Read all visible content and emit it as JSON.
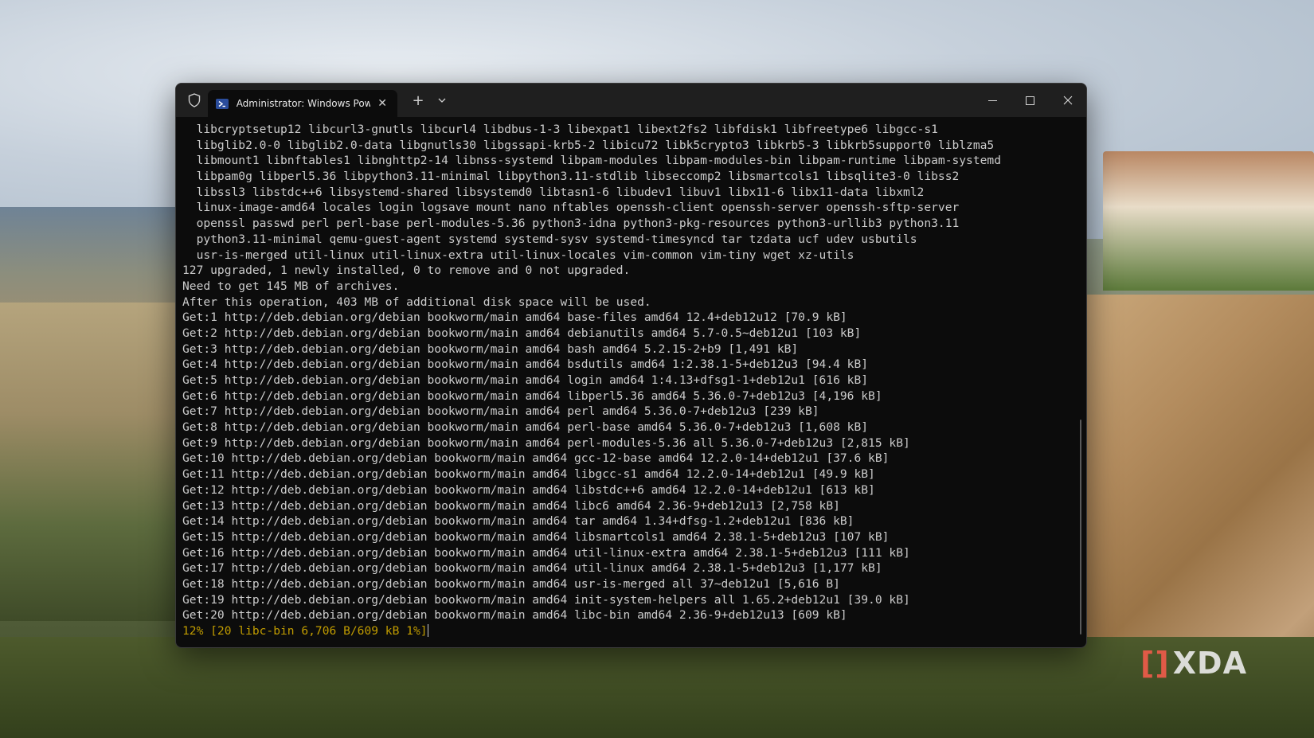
{
  "window": {
    "tab_title": "Administrator: Windows Powe",
    "new_tab_symbol": "+",
    "close_tab_symbol": "✕"
  },
  "terminal": {
    "package_lines": [
      "  libcryptsetup12 libcurl3-gnutls libcurl4 libdbus-1-3 libexpat1 libext2fs2 libfdisk1 libfreetype6 libgcc-s1",
      "  libglib2.0-0 libglib2.0-data libgnutls30 libgssapi-krb5-2 libicu72 libk5crypto3 libkrb5-3 libkrb5support0 liblzma5",
      "  libmount1 libnftables1 libnghttp2-14 libnss-systemd libpam-modules libpam-modules-bin libpam-runtime libpam-systemd",
      "  libpam0g libperl5.36 libpython3.11-minimal libpython3.11-stdlib libseccomp2 libsmartcols1 libsqlite3-0 libss2",
      "  libssl3 libstdc++6 libsystemd-shared libsystemd0 libtasn1-6 libudev1 libuv1 libx11-6 libx11-data libxml2",
      "  linux-image-amd64 locales login logsave mount nano nftables openssh-client openssh-server openssh-sftp-server",
      "  openssl passwd perl perl-base perl-modules-5.36 python3-idna python3-pkg-resources python3-urllib3 python3.11",
      "  python3.11-minimal qemu-guest-agent systemd systemd-sysv systemd-timesyncd tar tzdata ucf udev usbutils",
      "  usr-is-merged util-linux util-linux-extra util-linux-locales vim-common vim-tiny wget xz-utils"
    ],
    "summary_lines": [
      "127 upgraded, 1 newly installed, 0 to remove and 0 not upgraded.",
      "Need to get 145 MB of archives.",
      "After this operation, 403 MB of additional disk space will be used."
    ],
    "get_lines": [
      "Get:1 http://deb.debian.org/debian bookworm/main amd64 base-files amd64 12.4+deb12u12 [70.9 kB]",
      "Get:2 http://deb.debian.org/debian bookworm/main amd64 debianutils amd64 5.7-0.5~deb12u1 [103 kB]",
      "Get:3 http://deb.debian.org/debian bookworm/main amd64 bash amd64 5.2.15-2+b9 [1,491 kB]",
      "Get:4 http://deb.debian.org/debian bookworm/main amd64 bsdutils amd64 1:2.38.1-5+deb12u3 [94.4 kB]",
      "Get:5 http://deb.debian.org/debian bookworm/main amd64 login amd64 1:4.13+dfsg1-1+deb12u1 [616 kB]",
      "Get:6 http://deb.debian.org/debian bookworm/main amd64 libperl5.36 amd64 5.36.0-7+deb12u3 [4,196 kB]",
      "Get:7 http://deb.debian.org/debian bookworm/main amd64 perl amd64 5.36.0-7+deb12u3 [239 kB]",
      "Get:8 http://deb.debian.org/debian bookworm/main amd64 perl-base amd64 5.36.0-7+deb12u3 [1,608 kB]",
      "Get:9 http://deb.debian.org/debian bookworm/main amd64 perl-modules-5.36 all 5.36.0-7+deb12u3 [2,815 kB]",
      "Get:10 http://deb.debian.org/debian bookworm/main amd64 gcc-12-base amd64 12.2.0-14+deb12u1 [37.6 kB]",
      "Get:11 http://deb.debian.org/debian bookworm/main amd64 libgcc-s1 amd64 12.2.0-14+deb12u1 [49.9 kB]",
      "Get:12 http://deb.debian.org/debian bookworm/main amd64 libstdc++6 amd64 12.2.0-14+deb12u1 [613 kB]",
      "Get:13 http://deb.debian.org/debian bookworm/main amd64 libc6 amd64 2.36-9+deb12u13 [2,758 kB]",
      "Get:14 http://deb.debian.org/debian bookworm/main amd64 tar amd64 1.34+dfsg-1.2+deb12u1 [836 kB]",
      "Get:15 http://deb.debian.org/debian bookworm/main amd64 libsmartcols1 amd64 2.38.1-5+deb12u3 [107 kB]",
      "Get:16 http://deb.debian.org/debian bookworm/main amd64 util-linux-extra amd64 2.38.1-5+deb12u3 [111 kB]",
      "Get:17 http://deb.debian.org/debian bookworm/main amd64 util-linux amd64 2.38.1-5+deb12u3 [1,177 kB]",
      "Get:18 http://deb.debian.org/debian bookworm/main amd64 usr-is-merged all 37~deb12u1 [5,616 B]",
      "Get:19 http://deb.debian.org/debian bookworm/main amd64 init-system-helpers all 1.65.2+deb12u1 [39.0 kB]",
      "Get:20 http://deb.debian.org/debian bookworm/main amd64 libc-bin amd64 2.36-9+deb12u13 [609 kB]"
    ],
    "progress_line": "12% [20 libc-bin 6,706 B/609 kB 1%]"
  },
  "watermark": {
    "text": "XDA",
    "bracket": "[]"
  },
  "colors": {
    "terminal_bg": "#0c0c0c",
    "terminal_text": "#cccccc",
    "progress_text": "#c19c00",
    "titlebar_bg": "#1f1f1f",
    "brand_accent": "#e05a47"
  },
  "icons": {
    "shield": "shield-icon",
    "powershell": "powershell-icon",
    "minimize": "minimize-icon",
    "maximize": "maximize-icon",
    "close": "close-icon",
    "dropdown": "chevron-down-icon"
  }
}
